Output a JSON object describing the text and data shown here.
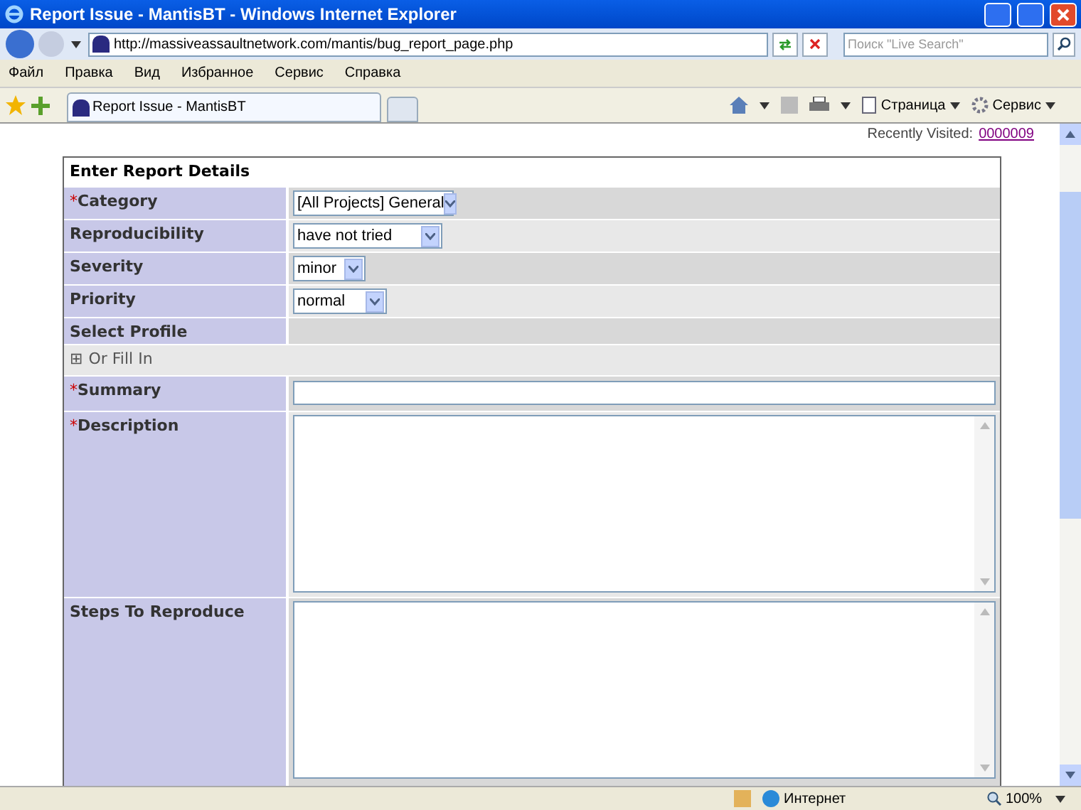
{
  "window": {
    "title": "Report Issue - MantisBT - Windows Internet Explorer"
  },
  "address": {
    "url": "http://massiveassaultnetwork.com/mantis/bug_report_page.php"
  },
  "search": {
    "placeholder": "Поиск \"Live Search\""
  },
  "menu": [
    "Файл",
    "Правка",
    "Вид",
    "Избранное",
    "Сервис",
    "Справка"
  ],
  "tabs": [
    {
      "label": "Report Issue - MantisBT",
      "selected": true
    }
  ],
  "command_bar": {
    "page": "Страница",
    "tools": "Сервис"
  },
  "recently_visited": {
    "label": "Recently Visited:",
    "link": "0000009"
  },
  "form": {
    "title": "Enter Report Details",
    "rows": [
      {
        "kind": "select",
        "mark": "*",
        "label": "Category",
        "value": "[All Projects] General"
      },
      {
        "kind": "select",
        "label": "Reproducibility",
        "value": "have not tried"
      },
      {
        "kind": "select",
        "label": "Severity",
        "value": "minor"
      },
      {
        "kind": "select",
        "label": "Priority",
        "value": "normal"
      },
      {
        "kind": "heading",
        "label": "Select Profile"
      },
      {
        "kind": "expand",
        "toggle": "⊞",
        "label": "Or Fill In"
      },
      {
        "kind": "text",
        "mark": "*",
        "label": "Summary"
      },
      {
        "kind": "textarea",
        "mark": "*",
        "label": "Description"
      },
      {
        "kind": "textarea",
        "label": "Steps To Reproduce"
      }
    ]
  },
  "status_bar": {
    "zone": "Интернет",
    "zoom": "100%"
  }
}
